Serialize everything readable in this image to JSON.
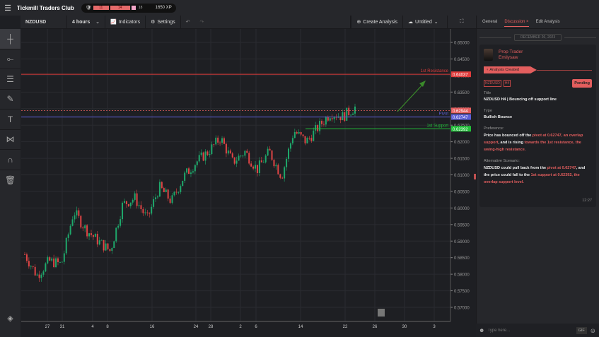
{
  "topbar": {
    "brand": "Tickmill Traders Club",
    "xp_levels": [
      "11",
      "14",
      "18"
    ],
    "xp": "1650 XP"
  },
  "toolbar": {
    "symbol": "NZDUSD",
    "interval": "4 hours",
    "indicators": "Indicators",
    "settings": "Settings",
    "create": "Create Analysis",
    "untitled": "Untitled"
  },
  "left_tools": [
    "crosshair-icon",
    "trend-line-icon",
    "fib-icon",
    "brush-icon",
    "text-icon",
    "pattern-icon",
    "magnet-icon",
    "trash-icon"
  ],
  "panel": {
    "tabs": [
      "General",
      "Discussion",
      "Edit Analysis"
    ],
    "date": "DECEMBER 26, 2023",
    "role": "Prop Trader",
    "user": "Emilysaw",
    "status_bar": "Analysis Created",
    "tags": [
      "NZDUSD",
      "H4"
    ],
    "pending": "Pending",
    "title_label": "Title",
    "title": "NZDUSD H4 | Bouncing off support line",
    "type_label": "Type",
    "type": "Bullish Bounce",
    "pref_label": "Preference:",
    "pref": [
      [
        "Price has bounced off the ",
        false
      ],
      [
        "pivot at 0.62747, an overlap support",
        true
      ],
      [
        ", and is rising ",
        false
      ],
      [
        "towards the 1st resistance, the swing-high resistance.",
        true
      ]
    ],
    "alt_label": "Alternative Scenario:",
    "alt": [
      [
        "NZDUSD could pull back from the ",
        false
      ],
      [
        "pivot at 0.62747",
        true
      ],
      [
        ", and the price could fall to the ",
        false
      ],
      [
        "1st support at 0.62392, the overlap support level.",
        true
      ]
    ],
    "time": "12:27",
    "input_placeholder": "Type here...",
    "gif": "GIF"
  },
  "colors": {
    "accent": "#e35e5e",
    "resistance": "#e03c3c",
    "pivot": "#5b5fd6",
    "support": "#22c03a",
    "bull": "#1ea86b",
    "bear": "#e04545"
  },
  "chart_data": {
    "type": "candlestick",
    "yticks": [
      "0.65000",
      "0.64500",
      "0.64000",
      "0.63500",
      "0.63000",
      "0.62500",
      "0.62000",
      "0.61500",
      "0.61000",
      "0.60500",
      "0.60000",
      "0.59500",
      "0.59000",
      "0.58500",
      "0.58000",
      "0.57500",
      "0.57000"
    ],
    "ylim": [
      0.57,
      0.65
    ],
    "xticks": [
      "27",
      "31",
      "4",
      "8",
      "16",
      "24",
      "28",
      "2",
      "6",
      "14",
      "22",
      "26",
      "30",
      "3"
    ],
    "path_closes": [
      0.586,
      0.5796,
      0.584,
      0.583,
      0.599,
      0.5935,
      0.59,
      0.587,
      0.601,
      0.603,
      0.5967,
      0.6063,
      0.602,
      0.6095,
      0.6138,
      0.617,
      0.6212,
      0.6138,
      0.617,
      0.6116,
      0.617,
      0.6095,
      0.6233,
      0.62,
      0.6244,
      0.6287,
      0.6276,
      0.6304
    ],
    "levels": [
      {
        "name": "1st Resistance",
        "value": 0.64037,
        "label": "0.64037",
        "color": "#e03c3c"
      },
      {
        "name": "",
        "value": 0.62944,
        "label": "0.62944",
        "color": "#e35e5e",
        "dashed": true
      },
      {
        "name": "Pivot",
        "value": 0.62747,
        "label": "0.62747",
        "color": "#5b5fd6"
      },
      {
        "name": "1st Support",
        "value": 0.62392,
        "label": "0.62392",
        "color": "#22c03a"
      }
    ]
  }
}
